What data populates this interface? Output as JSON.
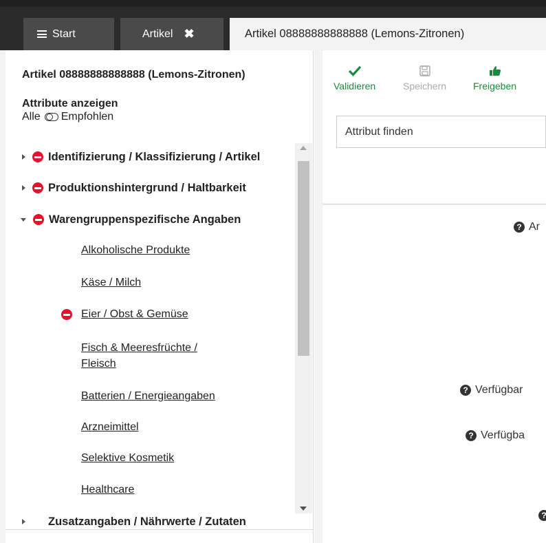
{
  "tabs": {
    "start_label": "Start",
    "artikel_label": "Artikel",
    "active_label": "Artikel 08888888888888 (Lemons-Zitronen)"
  },
  "left": {
    "article_title": "Artikel 08888888888888 (Lemons-Zitronen)",
    "attributes_heading": "Attribute anzeigen",
    "toggle_left": "Alle",
    "toggle_right": "Empfohlen",
    "groups": [
      {
        "label": "Identifizierung / Klassifizierung / Artikel",
        "expanded": false
      },
      {
        "label": "Produktionshintergrund / Haltbarkeit",
        "expanded": false
      },
      {
        "label": "Warengruppenspezifische Angaben",
        "expanded": true
      },
      {
        "label": "Zusatzangaben / Nährwerte / Zutaten",
        "expanded": false
      }
    ],
    "subitems": [
      {
        "label": "Alkoholische Produkte"
      },
      {
        "label": "Käse / Milch"
      },
      {
        "label": "Eier / Obst & Gemüse",
        "error": true
      },
      {
        "label": "Fisch & Meeresfrüchte /"
      },
      {
        "label": "Fleisch"
      },
      {
        "label": "Batterien / Energieangaben"
      },
      {
        "label": "Arzneimittel"
      },
      {
        "label": "Selektive Kosmetik"
      },
      {
        "label": "Healthcare"
      }
    ]
  },
  "toolbar": {
    "validate_label": "Validieren",
    "save_label": "Speichern",
    "release_label": "Freigeben"
  },
  "search": {
    "placeholder": "Attribut finden"
  },
  "content": {
    "help_items": [
      {
        "label": "Ar"
      },
      {
        "label": "Verfügbar"
      },
      {
        "label": "Verfügba"
      },
      {
        "label": ""
      }
    ]
  },
  "colors": {
    "error_red": "#e8112d",
    "success_green": "#1b8a3e",
    "tabbar": "#2b2b2b"
  }
}
